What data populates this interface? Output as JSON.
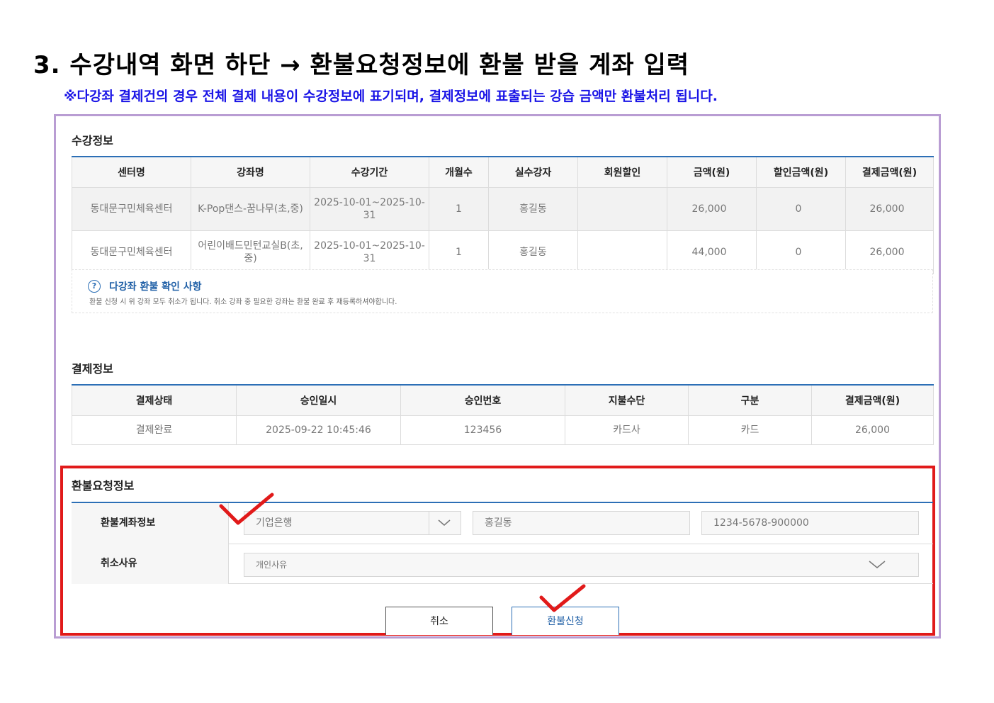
{
  "heading": {
    "title": "3. 수강내역 화면 하단 → 환불요청정보에 환불 받을 계좌 입력",
    "note": "※다강좌 결제건의 경우 전체 결제 내용이 수강정보에 표기되며, 결제정보에 표출되는 강습 금액만 환불처리 됩니다."
  },
  "course_section": {
    "title": "수강정보",
    "headers": [
      "센터명",
      "강좌명",
      "수강기간",
      "개월수",
      "실수강자",
      "회원할인",
      "금액(원)",
      "할인금액(원)",
      "결제금액(원)"
    ],
    "rows": [
      {
        "center": "동대문구민체육센터",
        "course": "K-Pop댄스-꿈나무(초,중)",
        "period": "2025-10-01~2025-10-31",
        "months": "1",
        "student": "홍길동",
        "discount": "",
        "amount": "26,000",
        "discount_amount": "0",
        "paid": "26,000"
      },
      {
        "center": "동대문구민체육센터",
        "course": "어린이배드민턴교실B(초,중)",
        "period": "2025-10-01~2025-10-31",
        "months": "1",
        "student": "홍길동",
        "discount": "",
        "amount": "44,000",
        "discount_amount": "0",
        "paid": "26,000"
      }
    ]
  },
  "notice": {
    "title": "다강좌 환불 확인 사항",
    "desc": "환불 신청 시 위 강좌 모두 취소가 됩니다. 취소 강좌 중 필요한 강좌는 환불 완료 후 재등록하셔야합니다."
  },
  "payment_section": {
    "title": "결제정보",
    "headers": [
      "결제상태",
      "승인일시",
      "승인번호",
      "지불수단",
      "구분",
      "결제금액(원)"
    ],
    "row": {
      "status": "결제완료",
      "approved_at": "2025-09-22 10:45:46",
      "approval_no": "123456",
      "method": "카드사",
      "type": "카드",
      "amount": "26,000"
    }
  },
  "refund_section": {
    "title": "환불요청정보",
    "account_label": "환불계좌정보",
    "bank_value": "기업은행",
    "holder_value": "홍길동",
    "account_value": "1234-5678-900000",
    "reason_label": "취소사유",
    "reason_value": "개인사유"
  },
  "buttons": {
    "cancel": "취소",
    "apply": "환불신청"
  },
  "colors": {
    "accent_blue": "#2c6fb6",
    "highlight_red": "#e11a1a",
    "frame_purple": "#b99dd3",
    "note_blue": "#1a14e6"
  }
}
